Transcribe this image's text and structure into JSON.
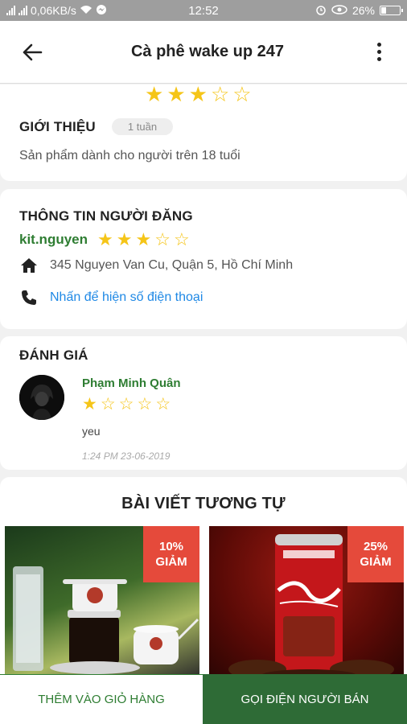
{
  "status_bar": {
    "network": "0,06KB/s",
    "time": "12:52",
    "battery": "26%"
  },
  "app_bar": {
    "title": "Cà phê wake up 247"
  },
  "product_rating": {
    "value": 3,
    "max": 5
  },
  "intro": {
    "heading": "GIỚI THIỆU",
    "age_badge": "1 tuần",
    "description": "Sản phẩm dành cho người trên 18 tuổi"
  },
  "seller": {
    "heading": "THÔNG TIN NGƯỜI ĐĂNG",
    "name": "kit.nguyen",
    "rating": {
      "value": 3,
      "max": 5
    },
    "address": "345 Nguyen Van Cu, Quận 5, Hồ Chí Minh",
    "phone_link": "Nhấn để hiện số điện thoại"
  },
  "reviews": {
    "heading": "ĐÁNH GIÁ",
    "items": [
      {
        "reviewer": "Phạm Minh Quân",
        "rating": {
          "value": 1,
          "max": 5
        },
        "text": "yeu",
        "time": "1:24 PM 23-06-2019"
      }
    ]
  },
  "similar": {
    "heading": "BÀI VIẾT TƯƠNG TỰ",
    "products": [
      {
        "discount_value": "10%",
        "discount_label": "GIẢM"
      },
      {
        "discount_value": "25%",
        "discount_label": "GIẢM"
      }
    ]
  },
  "actions": {
    "add_to_cart": "THÊM VÀO GIỎ HÀNG",
    "call_seller": "GỌI ĐIỆN NGƯỜI BÁN"
  },
  "colors": {
    "accent_green": "#2e7d32",
    "call_button": "#2e6b36",
    "link_blue": "#1e88e5",
    "star": "#f5c518",
    "discount": "#e54a3b"
  }
}
